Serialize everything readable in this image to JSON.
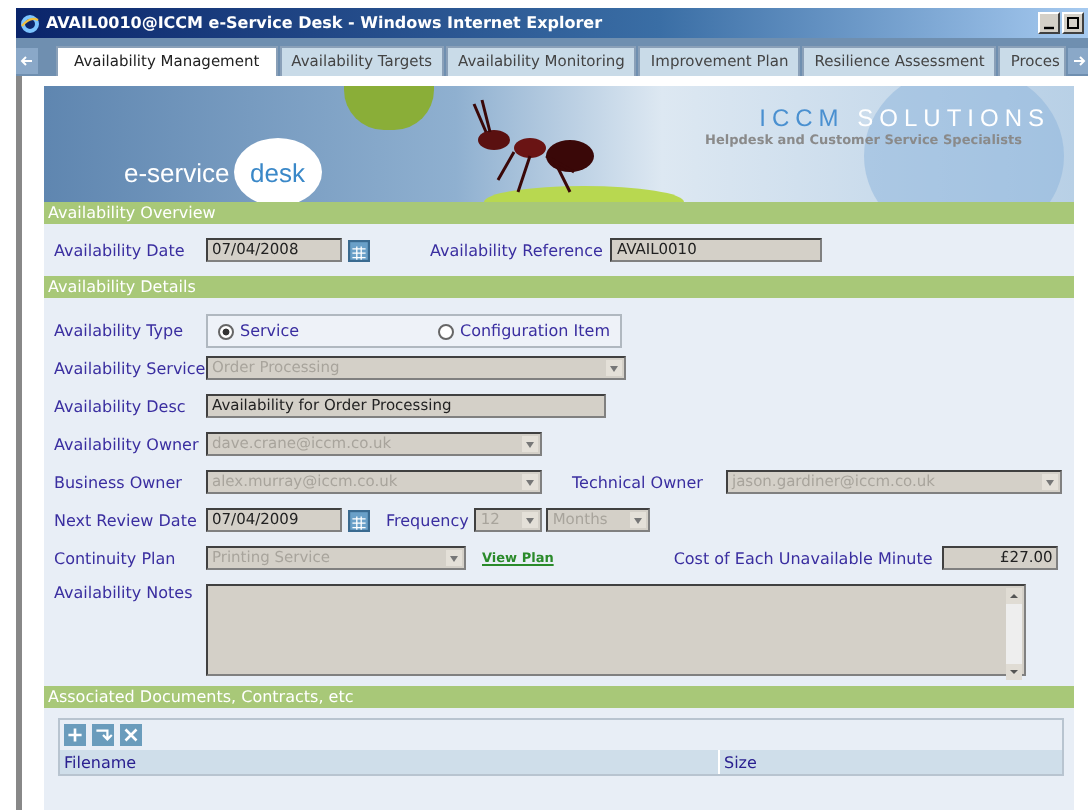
{
  "window": {
    "title": "AVAIL0010@ICCM e-Service Desk - Windows Internet Explorer"
  },
  "tabs": [
    {
      "label": "Availability Management",
      "selected": true
    },
    {
      "label": "Availability Targets",
      "selected": false
    },
    {
      "label": "Availability Monitoring",
      "selected": false
    },
    {
      "label": "Improvement Plan",
      "selected": false
    },
    {
      "label": "Resilience Assessment",
      "selected": false
    },
    {
      "label": "Proces",
      "selected": false
    }
  ],
  "banner": {
    "product_left": "e-service",
    "product_right": "desk",
    "company_first": "ICCM",
    "company_second": "SOLUTIONS",
    "tagline": "Helpdesk and Customer Service Specialists"
  },
  "overview": {
    "title": "Availability Overview",
    "date_label": "Availability Date",
    "date_value": "07/04/2008",
    "reference_label": "Availability Reference",
    "reference_value": "AVAIL0010"
  },
  "details": {
    "title": "Availability Details",
    "type_label": "Availability Type",
    "type_options": [
      {
        "label": "Service",
        "selected": true
      },
      {
        "label": "Configuration Item",
        "selected": false
      }
    ],
    "service": {
      "label": "Availability Service",
      "value": "Order Processing",
      "disabled": true
    },
    "desc": {
      "label": "Availability Desc",
      "value": "Availability for Order Processing",
      "disabled": false
    },
    "owner": {
      "label": "Availability Owner",
      "value": "dave.crane@iccm.co.uk",
      "disabled": true
    },
    "business_owner": {
      "label": "Business Owner",
      "value": "alex.murray@iccm.co.uk",
      "disabled": true
    },
    "technical_owner": {
      "label": "Technical Owner",
      "value": "jason.gardiner@iccm.co.uk",
      "disabled": true
    },
    "review": {
      "label": "Next Review Date",
      "value": "07/04/2009",
      "disabled": false
    },
    "frequency": {
      "label": "Frequency",
      "value": "12",
      "unit": "Months",
      "disabled": true
    },
    "continuity": {
      "label": "Continuity Plan",
      "value": "Printing Service",
      "disabled": true,
      "link": "View Plan"
    },
    "cost": {
      "label": "Cost of Each Unavailable Minute",
      "value": "£27.00"
    },
    "notes": {
      "label": "Availability Notes"
    }
  },
  "documents": {
    "title": "Associated Documents, Contracts, etc",
    "columns": [
      "Filename",
      "Size"
    ]
  }
}
